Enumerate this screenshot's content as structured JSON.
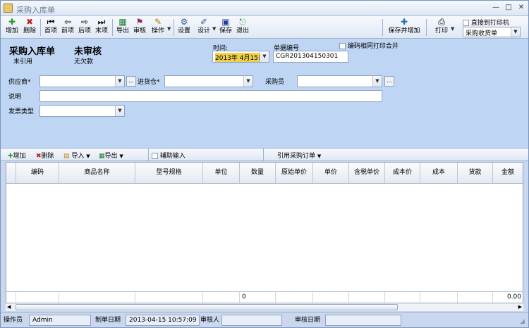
{
  "window": {
    "title": "采购入库单",
    "controls": [
      "—",
      "□",
      "✕"
    ]
  },
  "toolbar": {
    "add": "增加",
    "delete": "删除",
    "first": "首项",
    "prev": "前项",
    "next": "后项",
    "last": "末项",
    "export": "导出",
    "audit": "审核",
    "operate": "操作",
    "settings": "设置",
    "design": "设计",
    "save": "保存",
    "exit": "退出",
    "save_add": "保存并增加",
    "print": "打印",
    "print_direct": "直接到打印机",
    "print_template": "采购收货单"
  },
  "form": {
    "doc_title": "采购入库单",
    "audit_status": "未审核",
    "ref_status": "未引用",
    "debt_status": "无欠款",
    "time_label": "时间:",
    "time_value": "2013年 4月15日",
    "docno_label": "单据编号",
    "docno_value": "CGR201304150301",
    "merge_print_label": "编码相同打印合并",
    "supplier_label": "供应商*",
    "warehouse_label": "进货仓*",
    "buyer_label": "采购员",
    "note_label": "说明",
    "invoice_label": "发票类型"
  },
  "grid_toolbar": {
    "add": "增加",
    "delete": "删除",
    "import": "导入",
    "export": "导出",
    "aux_input": "辅助输入",
    "ref_order": "引用采购订单"
  },
  "grid": {
    "columns": [
      "编码",
      "商品名称",
      "型号规格",
      "单位",
      "数量",
      "原始单价",
      "单价",
      "含税单价",
      "成本价",
      "成本",
      "货款",
      "金额"
    ],
    "footer_qty": "0",
    "footer_amount": "0.00"
  },
  "status": {
    "operator_label": "操作员",
    "operator_value": "Admin",
    "created_label": "制单日期",
    "created_value": "2013-04-15 10:57:09",
    "auditor_label": "审核人",
    "auditor_value": "",
    "audit_date_label": "审核日期",
    "audit_date_value": ""
  }
}
